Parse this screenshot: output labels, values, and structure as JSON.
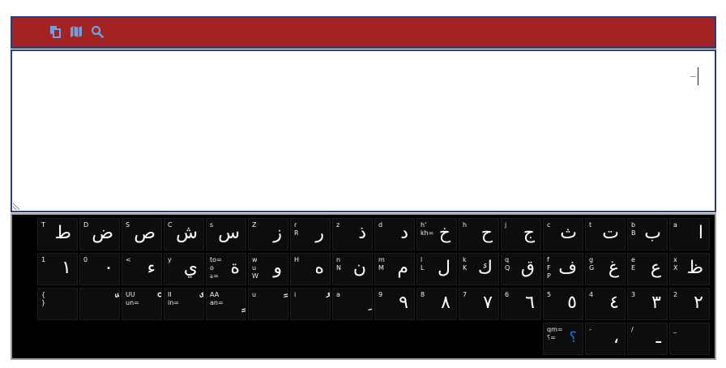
{
  "toolbar": {
    "icons": [
      "copy-icon",
      "map-icon",
      "search-icon"
    ],
    "background": "#a52222",
    "icon_color": "#6fa1e0"
  },
  "editor": {
    "value": "",
    "border_color": "#2a3e7a"
  },
  "keyboard": {
    "rows": [
      [
        {
          "latin": "T",
          "arabic": "ط"
        },
        {
          "latin": "D",
          "arabic": "ض"
        },
        {
          "latin": "S",
          "arabic": "ص"
        },
        {
          "latin": "C",
          "arabic": "ش"
        },
        {
          "latin": "s",
          "arabic": "س"
        },
        {
          "latin": "Z",
          "arabic": "ز"
        },
        {
          "latin": "r\nR",
          "arabic": "ر"
        },
        {
          "latin": "z",
          "arabic": "ذ"
        },
        {
          "latin": "d",
          "arabic": "د"
        },
        {
          "latin": "h'\nkh=",
          "arabic": "خ"
        },
        {
          "latin": "h",
          "arabic": "ح"
        },
        {
          "latin": "j",
          "arabic": "ج"
        },
        {
          "latin": "c",
          "arabic": "ث"
        },
        {
          "latin": "t",
          "arabic": "ت"
        },
        {
          "latin": "b\nB",
          "arabic": "ب"
        },
        {
          "latin": "a",
          "arabic": "ا"
        }
      ],
      [
        {
          "latin": "1",
          "arabic": "١"
        },
        {
          "latin": "0",
          "arabic": "٠"
        },
        {
          "latin": "<",
          "arabic": "ء"
        },
        {
          "latin": "y",
          "arabic": "ي"
        },
        {
          "latin": "to=\no\nة=",
          "arabic": "ة"
        },
        {
          "latin": "w\nu\nW",
          "arabic": "و"
        },
        {
          "latin": "H",
          "arabic": "ه"
        },
        {
          "latin": "n\nN",
          "arabic": "ن"
        },
        {
          "latin": "m\nM",
          "arabic": "م"
        },
        {
          "latin": "l\nL",
          "arabic": "ل"
        },
        {
          "latin": "k\nK",
          "arabic": "ك"
        },
        {
          "latin": "q\nQ",
          "arabic": "ق"
        },
        {
          "latin": "f\nF\nP",
          "arabic": "ف"
        },
        {
          "latin": "g\nG",
          "arabic": "غ"
        },
        {
          "latin": "e\nE",
          "arabic": "ع"
        },
        {
          "latin": "x\nX",
          "arabic": "ظ"
        }
      ],
      [
        {
          "latin": "{\n}",
          "arabic": ""
        },
        {
          "latin": "",
          "arabic": "ّ"
        },
        {
          "latin": "UU\nun=",
          "arabic": "ْ"
        },
        {
          "latin": "II\nin=",
          "arabic": "ٌ"
        },
        {
          "latin": "AA\nan=",
          "arabic": "ٍ"
        },
        {
          "latin": "u",
          "arabic": "ً"
        },
        {
          "latin": "i",
          "arabic": "ُ"
        },
        {
          "latin": "a",
          "arabic": "ِ"
        },
        {
          "latin": "9",
          "arabic": "٩"
        },
        {
          "latin": "8",
          "arabic": "٨"
        },
        {
          "latin": "7",
          "arabic": "٧"
        },
        {
          "latin": "6",
          "arabic": "٦"
        },
        {
          "latin": "5",
          "arabic": "٥"
        },
        {
          "latin": "4",
          "arabic": "٤"
        },
        {
          "latin": "3",
          "arabic": "٣"
        },
        {
          "latin": "2",
          "arabic": "٢"
        }
      ],
      [
        {
          "latin": "qm=\n؟=",
          "arabic": "؟",
          "blue": true
        },
        {
          "latin": "-",
          "arabic": "،"
        },
        {
          "latin": "/",
          "arabic": "ـ"
        },
        {
          "latin": "_",
          "arabic": ""
        }
      ]
    ]
  }
}
